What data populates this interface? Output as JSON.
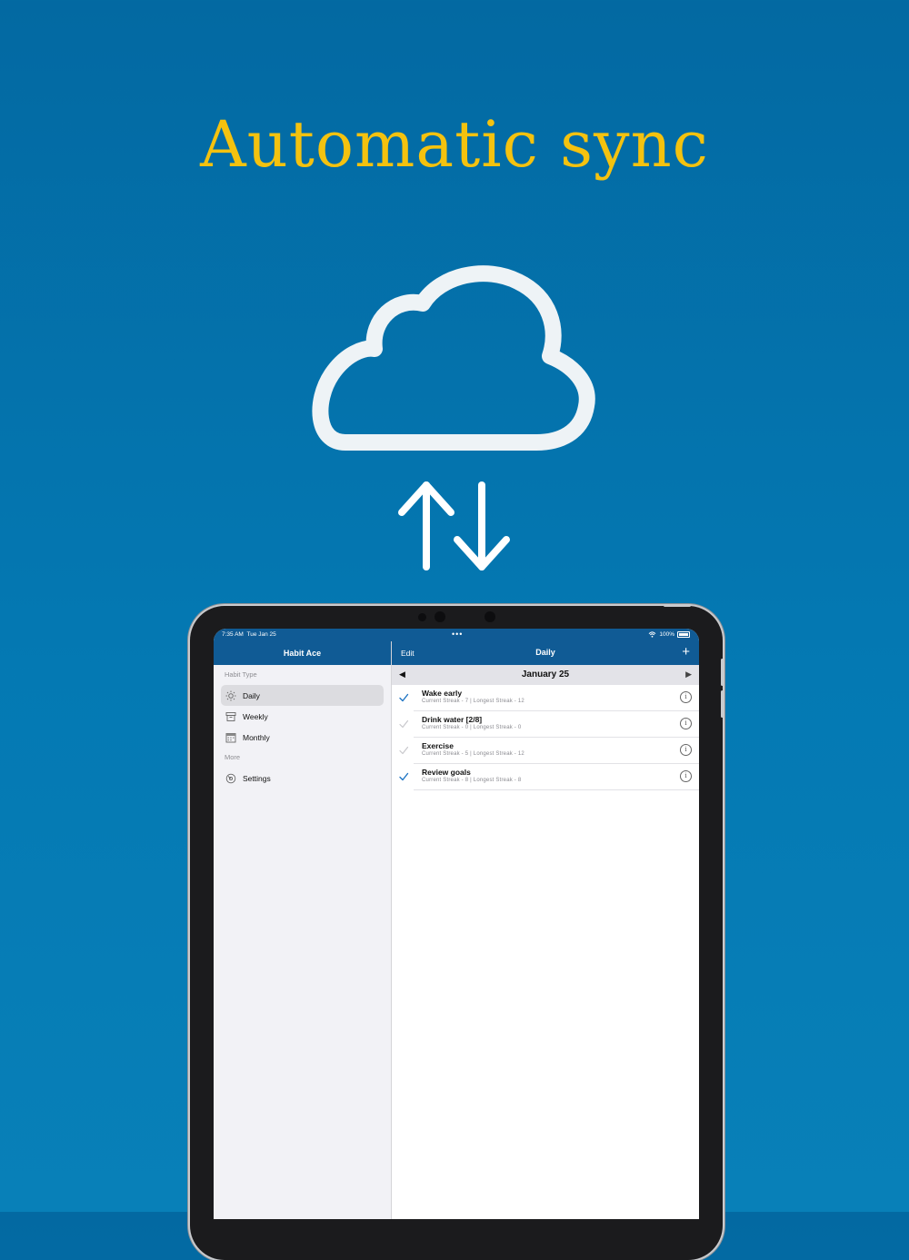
{
  "headline": "Automatic sync",
  "colors": {
    "headline": "#f4c20f",
    "background": "#0479b3",
    "navbar": "#105b95",
    "check": "#1f75c4"
  },
  "status_bar": {
    "time": "7:35 AM",
    "date": "Tue Jan 25",
    "battery": "100%"
  },
  "sidebar": {
    "title": "Habit Ace",
    "section_habit_type": "Habit Type",
    "items": [
      {
        "label": "Daily",
        "icon": "sun-icon",
        "selected": true
      },
      {
        "label": "Weekly",
        "icon": "archive-box-icon",
        "selected": false
      },
      {
        "label": "Monthly",
        "icon": "calendar-icon",
        "selected": false
      }
    ],
    "section_more": "More",
    "settings_label": "Settings"
  },
  "main": {
    "edit_label": "Edit",
    "title": "Daily",
    "add_icon": "plus-icon",
    "date": "January 25",
    "habits": [
      {
        "name": "Wake early",
        "streak": "Current Streak - 7 | Longest Streak - 12",
        "done": true
      },
      {
        "name": "Drink water [2/8]",
        "streak": "Current Streak - 0 | Longest Streak - 0",
        "done": false
      },
      {
        "name": "Exercise",
        "streak": "Current Streak - 5 | Longest Streak - 12",
        "done": false
      },
      {
        "name": "Review goals",
        "streak": "Current Streak - 8 | Longest Streak - 8",
        "done": true
      }
    ]
  }
}
